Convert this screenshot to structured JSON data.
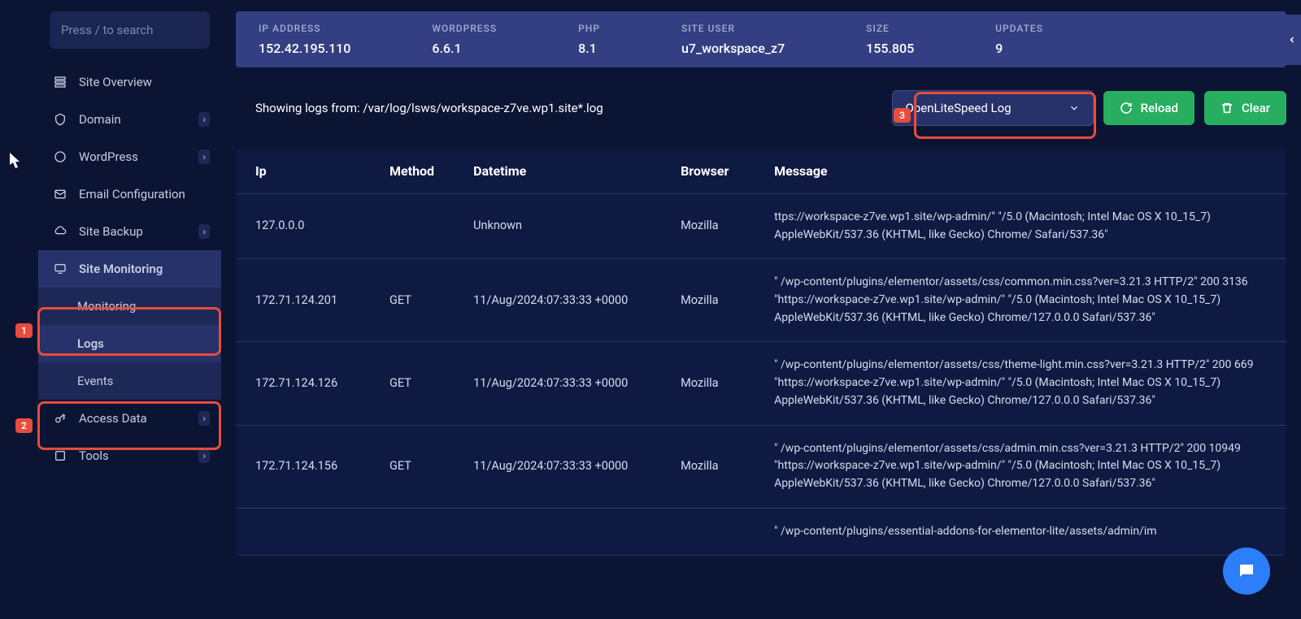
{
  "search": {
    "placeholder": "Press / to search"
  },
  "nav": {
    "site_overview": "Site Overview",
    "domain": "Domain",
    "wordpress": "WordPress",
    "email": "Email Configuration",
    "backup": "Site Backup",
    "monitoring": "Site Monitoring",
    "sub_monitoring": "Monitoring",
    "sub_logs": "Logs",
    "sub_events": "Events",
    "access_data": "Access Data",
    "tools": "Tools"
  },
  "stats": {
    "ip_label": "IP ADDRESS",
    "ip_value": "152.42.195.110",
    "wp_label": "WORDPRESS",
    "wp_value": "6.6.1",
    "php_label": "PHP",
    "php_value": "8.1",
    "user_label": "SITE USER",
    "user_value": "u7_workspace_z7",
    "size_label": "SIZE",
    "size_value": "155.805",
    "updates_label": "UPDATES",
    "updates_value": "9"
  },
  "logs_from_prefix": "Showing logs from: ",
  "logs_from_path": "/var/log/lsws/workspace-z7ve.wp1.site*.log",
  "dropdown_value": "OpenLiteSpeed Log",
  "btn_reload": "Reload",
  "btn_clear": "Clear",
  "badges": {
    "b1": "1",
    "b2": "2",
    "b3": "3"
  },
  "table": {
    "headers": {
      "ip": "Ip",
      "method": "Method",
      "datetime": "Datetime",
      "browser": "Browser",
      "message": "Message"
    },
    "rows": [
      {
        "ip": "127.0.0.0",
        "method": "",
        "datetime": "Unknown",
        "browser": "Mozilla",
        "message": "ttps://workspace-z7ve.wp1.site/wp-admin/\" \"/5.0 (Macintosh; Intel Mac OS X 10_15_7) AppleWebKit/537.36 (KHTML, like Gecko) Chrome/ Safari/537.36\""
      },
      {
        "ip": "172.71.124.201",
        "method": "GET",
        "datetime": "11/Aug/2024:07:33:33 +0000",
        "browser": "Mozilla",
        "message": "\" /wp-content/plugins/elementor/assets/css/common.min.css?ver=3.21.3 HTTP/2\" 200 3136 \"https://workspace-z7ve.wp1.site/wp-admin/\" \"/5.0 (Macintosh; Intel Mac OS X 10_15_7) AppleWebKit/537.36 (KHTML, like Gecko) Chrome/127.0.0.0 Safari/537.36\""
      },
      {
        "ip": "172.71.124.126",
        "method": "GET",
        "datetime": "11/Aug/2024:07:33:33 +0000",
        "browser": "Mozilla",
        "message": "\" /wp-content/plugins/elementor/assets/css/theme-light.min.css?ver=3.21.3 HTTP/2\" 200 669 \"https://workspace-z7ve.wp1.site/wp-admin/\" \"/5.0 (Macintosh; Intel Mac OS X 10_15_7) AppleWebKit/537.36 (KHTML, like Gecko) Chrome/127.0.0.0 Safari/537.36\""
      },
      {
        "ip": "172.71.124.156",
        "method": "GET",
        "datetime": "11/Aug/2024:07:33:33 +0000",
        "browser": "Mozilla",
        "message": "\" /wp-content/plugins/elementor/assets/css/admin.min.css?ver=3.21.3 HTTP/2\" 200 10949 \"https://workspace-z7ve.wp1.site/wp-admin/\" \"/5.0 (Macintosh; Intel Mac OS X 10_15_7) AppleWebKit/537.36 (KHTML, like Gecko) Chrome/127.0.0.0 Safari/537.36\""
      },
      {
        "ip": "",
        "method": "",
        "datetime": "",
        "browser": "",
        "message": "\" /wp-content/plugins/essential-addons-for-elementor-lite/assets/admin/im"
      }
    ]
  }
}
